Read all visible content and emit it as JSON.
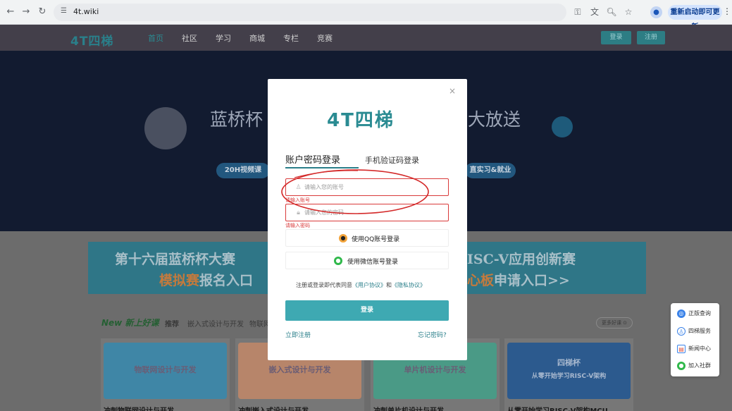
{
  "browser": {
    "url": "4t.wiki",
    "update_label": "重新启动即可更新"
  },
  "site": {
    "logo": "4T四梯",
    "nav": [
      "首页",
      "社区",
      "学习",
      "商城",
      "专栏",
      "竞赛"
    ],
    "login_btn": "登录",
    "register_btn": "注册"
  },
  "banner": {
    "title_left": "蓝桥杯",
    "title_right": "大放送",
    "tag_left": "20H视频课",
    "tag_right": "直实习&就业"
  },
  "promo": {
    "left_line1": "第十六届蓝桥杯大赛",
    "left_line2_hl": "模拟赛",
    "left_line2": "报名入口",
    "right_line1": "ISC-V应用创新赛",
    "right_line2_hl": "心板",
    "right_line2": "申请入口>>"
  },
  "courses": {
    "new_label": "New 新上好课",
    "tab_recommend": "推荐",
    "tab_embedded": "嵌入式设计与开发",
    "tab_iot": "物联网",
    "more": "更多好课 ⊙",
    "cards": [
      {
        "img_text": "物联网设计与开发",
        "title": "冲刺物联网设计与开发"
      },
      {
        "img_text": "嵌入式设计与开发",
        "title": "冲刺嵌入式设计与开发"
      },
      {
        "img_text": "单片机设计与开发",
        "title": "冲刺单片机设计与开发"
      },
      {
        "img_text": "四梯杯",
        "img_sub": "从零开始学习RISC-V架构",
        "title": "从零开始学习RISC-V架构MCU"
      }
    ]
  },
  "float_panel": {
    "items": [
      "正版查询",
      "四梯服务",
      "新闻中心",
      "加入社群"
    ]
  },
  "login": {
    "logo": "4T四梯",
    "tab_password": "账户密码登录",
    "tab_sms": "手机验证码登录",
    "account_placeholder": "请输入您的账号",
    "account_error": "请输入账号",
    "password_placeholder": "请输入您的密码",
    "password_error": "请输入密码",
    "qq_label": "使用QQ账号登录",
    "wechat_label": "使用微信账号登录",
    "agree_prefix": "注册或登录即代表同意",
    "agree_user": "《用户协议》",
    "agree_and": "和",
    "agree_privacy": "《隐私协议》",
    "submit": "登录",
    "register_link": "立即注册",
    "forgot_link": "忘记密码?"
  },
  "colors": {
    "brand_teal": "#2a8b92",
    "login_button": "#3ea9b2",
    "error_red": "#d93a3a"
  }
}
